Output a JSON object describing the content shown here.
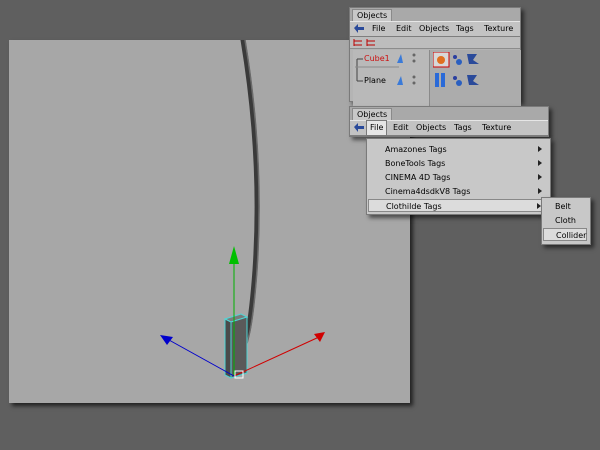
{
  "manager_top": {
    "tab_label": "Objects",
    "menu": [
      "File",
      "Edit",
      "Objects",
      "Tags",
      "Texture"
    ],
    "objects": [
      {
        "name": "Cube1",
        "selected": true
      },
      {
        "name": "Plane",
        "selected": false
      }
    ]
  },
  "manager_bottom": {
    "tab_label": "Objects",
    "menu": [
      "File",
      "Edit",
      "Objects",
      "Tags",
      "Texture"
    ],
    "active_menu": "File"
  },
  "dropdown": {
    "items": [
      {
        "label": "Amazones Tags",
        "submenu": true
      },
      {
        "label": "BoneTools Tags",
        "submenu": true
      },
      {
        "label": "CINEMA 4D Tags",
        "submenu": true
      },
      {
        "label": "Cinema4dsdkV8 Tags",
        "submenu": true
      },
      {
        "label": "Clothilde Tags",
        "submenu": true,
        "highlighted": true
      }
    ]
  },
  "submenu": {
    "items": [
      {
        "label": "Belt"
      },
      {
        "label": "Cloth"
      },
      {
        "label": "Collider",
        "highlighted": true
      }
    ]
  },
  "colors": {
    "background": "#5f5f5f",
    "viewport": "#a7a7a7",
    "panel": "#b4b4b4",
    "selected_object_text": "#cc1111",
    "axis_x": "#d00000",
    "axis_y": "#00b000",
    "axis_z": "#0000cc",
    "selection_outline": "#4fd6d6"
  }
}
